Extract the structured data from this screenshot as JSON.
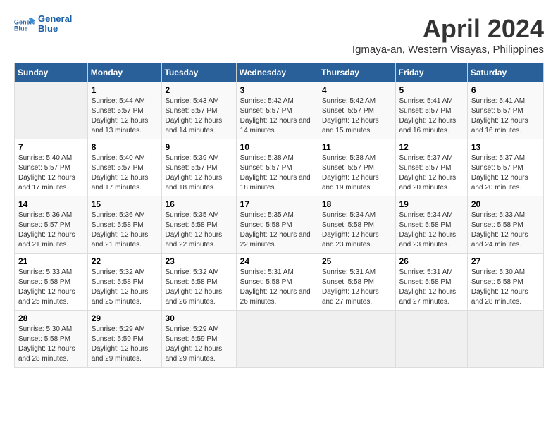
{
  "header": {
    "logo_line1": "General",
    "logo_line2": "Blue",
    "month_title": "April 2024",
    "subtitle": "Igmaya-an, Western Visayas, Philippines"
  },
  "columns": [
    "Sunday",
    "Monday",
    "Tuesday",
    "Wednesday",
    "Thursday",
    "Friday",
    "Saturday"
  ],
  "weeks": [
    [
      {
        "day": "",
        "empty": true
      },
      {
        "day": "1",
        "sunrise": "5:44 AM",
        "sunset": "5:57 PM",
        "daylight": "12 hours and 13 minutes."
      },
      {
        "day": "2",
        "sunrise": "5:43 AM",
        "sunset": "5:57 PM",
        "daylight": "12 hours and 14 minutes."
      },
      {
        "day": "3",
        "sunrise": "5:42 AM",
        "sunset": "5:57 PM",
        "daylight": "12 hours and 14 minutes."
      },
      {
        "day": "4",
        "sunrise": "5:42 AM",
        "sunset": "5:57 PM",
        "daylight": "12 hours and 15 minutes."
      },
      {
        "day": "5",
        "sunrise": "5:41 AM",
        "sunset": "5:57 PM",
        "daylight": "12 hours and 16 minutes."
      },
      {
        "day": "6",
        "sunrise": "5:41 AM",
        "sunset": "5:57 PM",
        "daylight": "12 hours and 16 minutes."
      }
    ],
    [
      {
        "day": "7",
        "sunrise": "5:40 AM",
        "sunset": "5:57 PM",
        "daylight": "12 hours and 17 minutes."
      },
      {
        "day": "8",
        "sunrise": "5:40 AM",
        "sunset": "5:57 PM",
        "daylight": "12 hours and 17 minutes."
      },
      {
        "day": "9",
        "sunrise": "5:39 AM",
        "sunset": "5:57 PM",
        "daylight": "12 hours and 18 minutes."
      },
      {
        "day": "10",
        "sunrise": "5:38 AM",
        "sunset": "5:57 PM",
        "daylight": "12 hours and 18 minutes."
      },
      {
        "day": "11",
        "sunrise": "5:38 AM",
        "sunset": "5:57 PM",
        "daylight": "12 hours and 19 minutes."
      },
      {
        "day": "12",
        "sunrise": "5:37 AM",
        "sunset": "5:57 PM",
        "daylight": "12 hours and 20 minutes."
      },
      {
        "day": "13",
        "sunrise": "5:37 AM",
        "sunset": "5:57 PM",
        "daylight": "12 hours and 20 minutes."
      }
    ],
    [
      {
        "day": "14",
        "sunrise": "5:36 AM",
        "sunset": "5:57 PM",
        "daylight": "12 hours and 21 minutes."
      },
      {
        "day": "15",
        "sunrise": "5:36 AM",
        "sunset": "5:58 PM",
        "daylight": "12 hours and 21 minutes."
      },
      {
        "day": "16",
        "sunrise": "5:35 AM",
        "sunset": "5:58 PM",
        "daylight": "12 hours and 22 minutes."
      },
      {
        "day": "17",
        "sunrise": "5:35 AM",
        "sunset": "5:58 PM",
        "daylight": "12 hours and 22 minutes."
      },
      {
        "day": "18",
        "sunrise": "5:34 AM",
        "sunset": "5:58 PM",
        "daylight": "12 hours and 23 minutes."
      },
      {
        "day": "19",
        "sunrise": "5:34 AM",
        "sunset": "5:58 PM",
        "daylight": "12 hours and 23 minutes."
      },
      {
        "day": "20",
        "sunrise": "5:33 AM",
        "sunset": "5:58 PM",
        "daylight": "12 hours and 24 minutes."
      }
    ],
    [
      {
        "day": "21",
        "sunrise": "5:33 AM",
        "sunset": "5:58 PM",
        "daylight": "12 hours and 25 minutes."
      },
      {
        "day": "22",
        "sunrise": "5:32 AM",
        "sunset": "5:58 PM",
        "daylight": "12 hours and 25 minutes."
      },
      {
        "day": "23",
        "sunrise": "5:32 AM",
        "sunset": "5:58 PM",
        "daylight": "12 hours and 26 minutes."
      },
      {
        "day": "24",
        "sunrise": "5:31 AM",
        "sunset": "5:58 PM",
        "daylight": "12 hours and 26 minutes."
      },
      {
        "day": "25",
        "sunrise": "5:31 AM",
        "sunset": "5:58 PM",
        "daylight": "12 hours and 27 minutes."
      },
      {
        "day": "26",
        "sunrise": "5:31 AM",
        "sunset": "5:58 PM",
        "daylight": "12 hours and 27 minutes."
      },
      {
        "day": "27",
        "sunrise": "5:30 AM",
        "sunset": "5:58 PM",
        "daylight": "12 hours and 28 minutes."
      }
    ],
    [
      {
        "day": "28",
        "sunrise": "5:30 AM",
        "sunset": "5:58 PM",
        "daylight": "12 hours and 28 minutes."
      },
      {
        "day": "29",
        "sunrise": "5:29 AM",
        "sunset": "5:59 PM",
        "daylight": "12 hours and 29 minutes."
      },
      {
        "day": "30",
        "sunrise": "5:29 AM",
        "sunset": "5:59 PM",
        "daylight": "12 hours and 29 minutes."
      },
      {
        "day": "",
        "empty": true
      },
      {
        "day": "",
        "empty": true
      },
      {
        "day": "",
        "empty": true
      },
      {
        "day": "",
        "empty": true
      }
    ]
  ],
  "labels": {
    "sunrise_prefix": "Sunrise: ",
    "sunset_prefix": "Sunset: ",
    "daylight_prefix": "Daylight: "
  }
}
